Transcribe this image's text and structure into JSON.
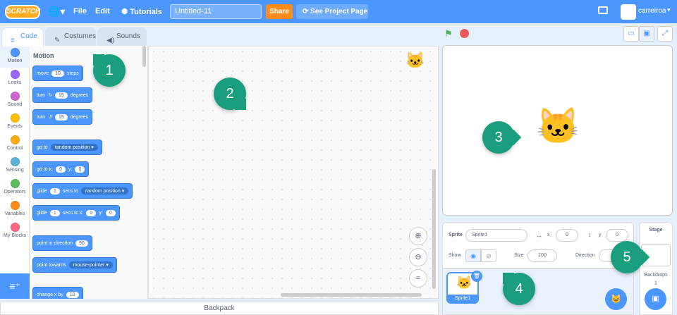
{
  "menubar": {
    "logo_text": "SCRATCH",
    "file": "File",
    "edit": "Edit",
    "tutorials": "Tutorials",
    "project_title": "Untitled-11",
    "share": "Share",
    "see_project_page": "See Project Page",
    "username": "carreiroa"
  },
  "tabs": {
    "code": "Code",
    "costumes": "Costumes",
    "sounds": "Sounds"
  },
  "categories": [
    {
      "label": "Motion",
      "color": "#4c97ff"
    },
    {
      "label": "Looks",
      "color": "#9966ff"
    },
    {
      "label": "Sound",
      "color": "#cf63cf"
    },
    {
      "label": "Events",
      "color": "#ffbf00"
    },
    {
      "label": "Control",
      "color": "#ffab19"
    },
    {
      "label": "Sensing",
      "color": "#5cb1d6"
    },
    {
      "label": "Operators",
      "color": "#59c059"
    },
    {
      "label": "Variables",
      "color": "#ff8c1a"
    },
    {
      "label": "My Blocks",
      "color": "#ff6680"
    }
  ],
  "palette": {
    "title": "Motion",
    "move": "move",
    "move_val": "10",
    "steps": "steps",
    "turn": "turn",
    "turn_cw_val": "15",
    "turn_ccw_val": "15",
    "degrees": "degrees",
    "goto": "go to",
    "goto_target": "random position",
    "gotoxy": "go to x:",
    "x_val": "0",
    "y_label": "y:",
    "y_val": "0",
    "glide": "glide",
    "glide_val": "1",
    "secs_to": "secs to",
    "glide_target": "random position",
    "glide2_val": "1",
    "secs_to_x": "secs to x:",
    "glide_x": "0",
    "glide_y": "0",
    "point_dir": "point in direction",
    "dir_val": "90",
    "point_towards": "point towards",
    "towards_target": "mouse-pointer",
    "change_x": "change x by",
    "change_x_val": "10"
  },
  "backpack": "Backpack",
  "sprite_info": {
    "sprite_label": "Sprite",
    "sprite_name": "Sprite1",
    "x_label": "x",
    "x_val": "0",
    "y_label": "y",
    "y_val": "0",
    "show_label": "Show",
    "size_label": "Size",
    "size_val": "100",
    "direction_label": "Direction"
  },
  "sprite_list": {
    "sprite1": "Sprite1"
  },
  "stage_selector": {
    "title": "Stage",
    "backdrops": "Backdrops",
    "count": "1"
  },
  "markers": [
    "1",
    "2",
    "3",
    "4",
    "5"
  ]
}
